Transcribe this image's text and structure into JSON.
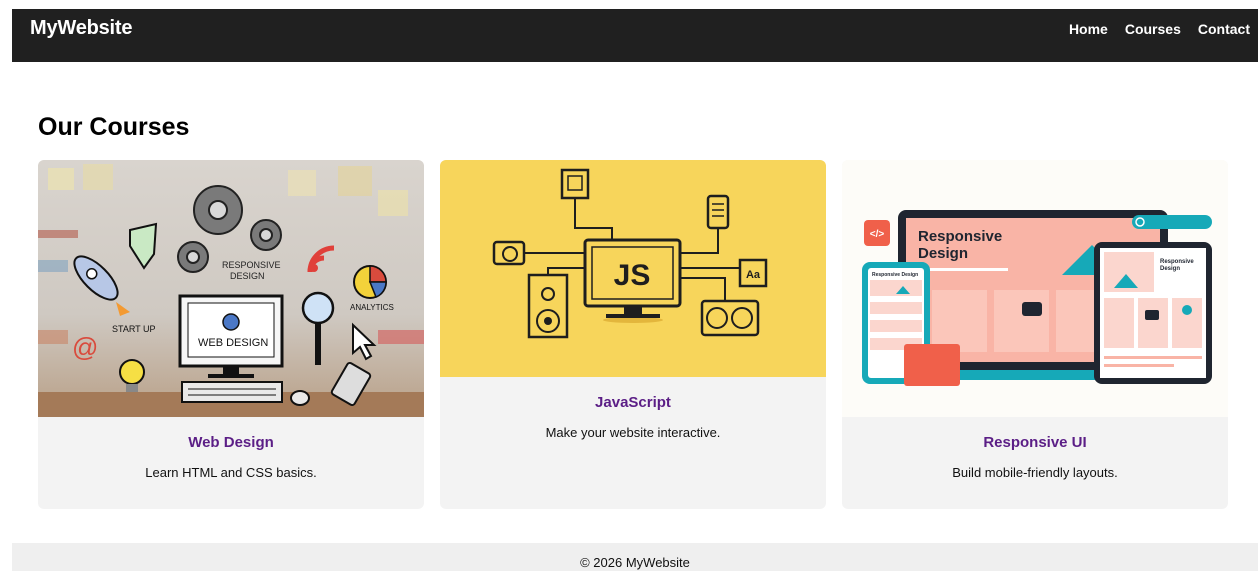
{
  "header": {
    "logo": "MyWebsite",
    "nav": [
      {
        "label": "Home"
      },
      {
        "label": "Courses"
      },
      {
        "label": "Contact"
      }
    ]
  },
  "main": {
    "title": "Our Courses",
    "cards": [
      {
        "title": "Web Design",
        "description": "Learn HTML and CSS basics.",
        "image_texts": [
          "RESPONSIVE",
          "DESIGN",
          "WEB DESIGN",
          "START UP",
          "ANALYTICS",
          "@"
        ]
      },
      {
        "title": "JavaScript",
        "description": "Make your website interactive.",
        "image_texts": [
          "JS",
          "Aa"
        ]
      },
      {
        "title": "Responsive UI",
        "description": "Build mobile-friendly layouts.",
        "image_texts": [
          "Responsive",
          "Design",
          "Responsive Design",
          "Responsive",
          "Design",
          "</>"
        ]
      }
    ]
  },
  "footer": {
    "text": "© 2026 MyWebsite"
  },
  "colors": {
    "header_bg": "#202020",
    "card_bg": "#f3f3f3",
    "card_title": "#5b1e86",
    "js_yellow": "#f7d55b",
    "responsive_pink": "#f9b4a6",
    "responsive_teal": "#16a9b8",
    "footer_bg": "#efefef"
  }
}
